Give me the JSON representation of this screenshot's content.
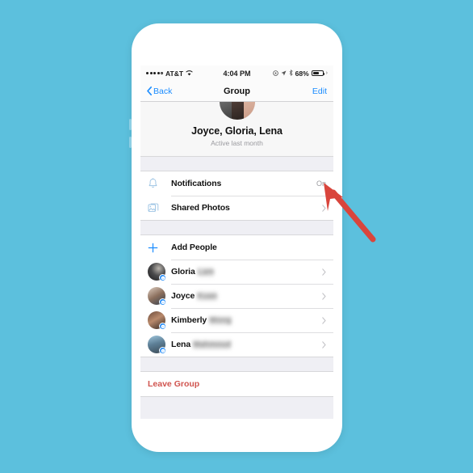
{
  "colors": {
    "background": "#5cc0dd",
    "phone_body": "#ffffff",
    "ios_blue": "#1a8cff",
    "arrow_red": "#d9453c",
    "leave_red": "#d0544f",
    "screen_gray": "#efeff4"
  },
  "status_bar": {
    "carrier": "AT&T",
    "time": "4:04 PM",
    "battery_percent": "68%",
    "signal_dots": 5,
    "wifi_icon": "wifi-icon",
    "alarm_icon": "alarm-icon",
    "location_icon": "location-arrow-icon",
    "bluetooth_icon": "bluetooth-icon",
    "battery_icon": "battery-icon"
  },
  "nav_bar": {
    "back_label": "Back",
    "title": "Group",
    "edit_label": "Edit"
  },
  "group_header": {
    "name": "Joyce, Gloria, Lena",
    "status": "Active last month"
  },
  "settings_section": {
    "rows": [
      {
        "label": "Notifications",
        "value": "On",
        "icon": "bell-icon",
        "chevron": false
      },
      {
        "label": "Shared Photos",
        "value": "",
        "icon": "photos-icon",
        "chevron": true
      }
    ]
  },
  "people_section": {
    "add_people_label": "Add People",
    "add_icon": "plus-icon",
    "members": [
      {
        "first_name": "Gloria",
        "last_name_blurred": "Lam",
        "avatar": "avatar-gloria",
        "badge": "messenger-badge-icon"
      },
      {
        "first_name": "Joyce",
        "last_name_blurred": "Kuan",
        "avatar": "avatar-joyce",
        "badge": "messenger-badge-icon"
      },
      {
        "first_name": "Kimberly",
        "last_name_blurred": "Wong",
        "avatar": "avatar-kimberly",
        "badge": "messenger-badge-icon"
      },
      {
        "first_name": "Lena",
        "last_name_blurred": "Mahmoud",
        "avatar": "avatar-lena",
        "badge": "messenger-badge-icon"
      }
    ]
  },
  "leave_section": {
    "label": "Leave Group"
  },
  "annotation": {
    "type": "arrow",
    "color": "#d9453c",
    "points_to": "Notifications row"
  }
}
